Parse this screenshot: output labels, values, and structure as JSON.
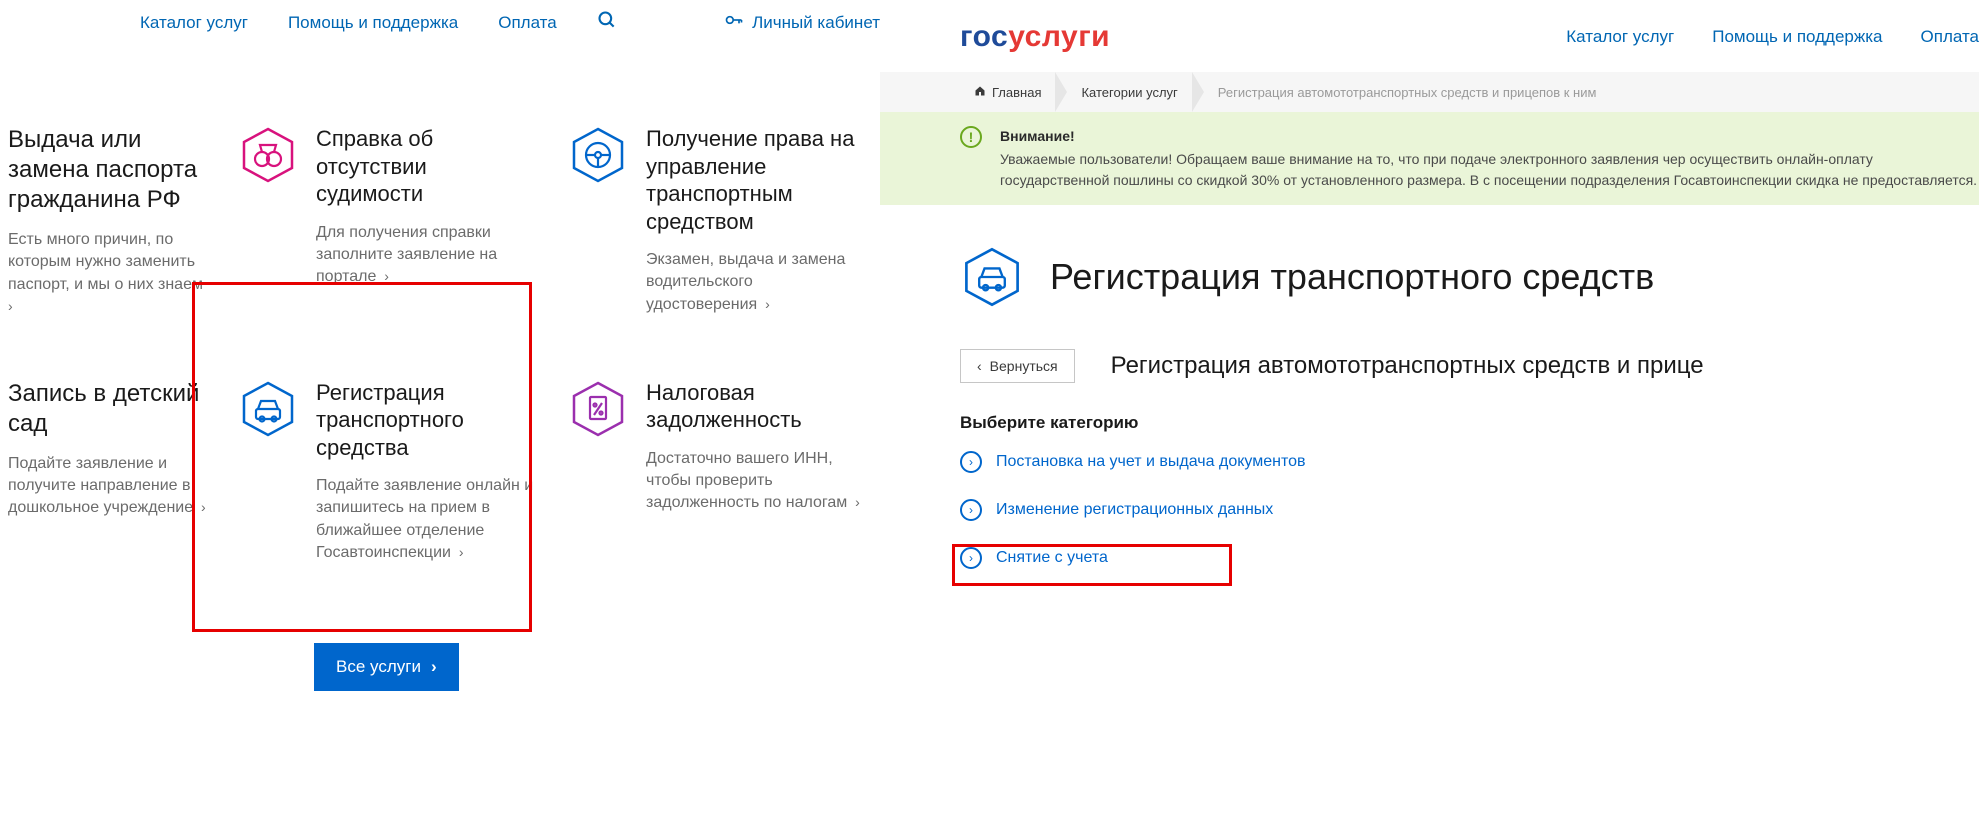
{
  "left": {
    "nav": {
      "catalog": "Каталог услуг",
      "help": "Помощь и поддержка",
      "payment": "Оплата",
      "cabinet": "Личный кабинет"
    },
    "cards": {
      "passport": {
        "title": "Выдача или замена паспорта гражданина РФ",
        "desc": "Есть много причин, по которым нужно заменить паспорт, и мы о них знаем"
      },
      "criminal": {
        "title": "Справка об отсутствии судимости",
        "desc": "Для получения справки заполните заявление на портале"
      },
      "driving": {
        "title": "Получение права на управление транспортным средством",
        "desc": "Экзамен, выдача и замена водительского удостоверения"
      },
      "kinder": {
        "title": "Запись в детский сад",
        "desc": "Подайте заявление и получите направление в дошкольное учреждение"
      },
      "vehicle": {
        "title": "Регистрация транспортного средства",
        "desc": "Подайте заявление онлайн и запишитесь на прием в ближайшее отделение Госавтоинспекции"
      },
      "tax": {
        "title": "Налоговая задолженность",
        "desc": "Достаточно вашего ИНН, чтобы проверить задолженность по налогам"
      }
    },
    "all_services": "Все услуги"
  },
  "right": {
    "logo": {
      "part1": "гос",
      "part2": "услуги"
    },
    "nav": {
      "catalog": "Каталог услуг",
      "help": "Помощь и поддержка",
      "payment": "Оплата"
    },
    "breadcrumbs": {
      "home": "Главная",
      "categories": "Категории услуг",
      "current": "Регистрация автомототранспортных средств и прицепов к ним"
    },
    "alert": {
      "title": "Внимание!",
      "text": "Уважаемые пользователи! Обращаем ваше внимание на то, что при подаче электронного заявления чер осуществить онлайн-оплату государственной пошлины со скидкой 30% от установленного размера. В с посещении подразделения Госавтоинспекции скидка не предоставляется."
    },
    "page_title": "Регистрация транспортного средств",
    "back": "Вернуться",
    "sub_title": "Регистрация автомототранспортных средств и прице",
    "choose_cat": "Выберите категорию",
    "cats": {
      "c1": "Постановка на учет и выдача документов",
      "c2": "Изменение регистрационных данных",
      "c3": "Снятие с учета"
    }
  }
}
